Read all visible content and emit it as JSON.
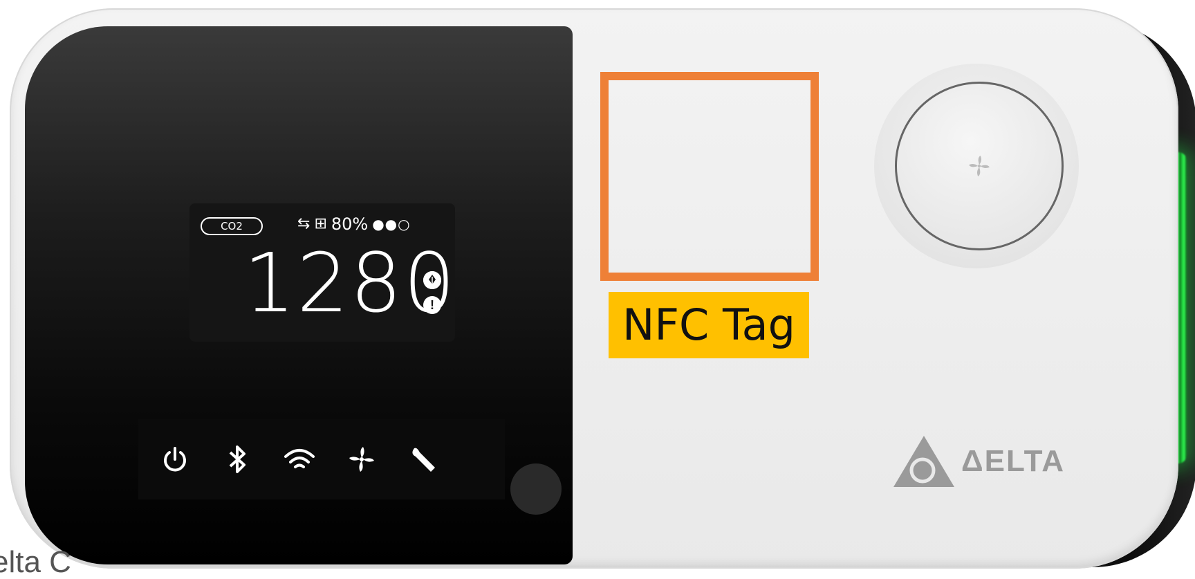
{
  "display": {
    "sensor_label": "CO2",
    "status_icons": [
      "sync-icon",
      "grid-icon"
    ],
    "humidity": "80%",
    "level_dots": "●●○",
    "reading": "1280",
    "indicator_icons": [
      "leaf-icon",
      "alert-icon"
    ]
  },
  "touch_controls": [
    {
      "name": "power-icon",
      "glyph": "⏻"
    },
    {
      "name": "bluetooth-icon",
      "glyph": "ᛒ"
    },
    {
      "name": "wifi-icon",
      "glyph": "wifi"
    },
    {
      "name": "fan-icon",
      "glyph": "fan"
    },
    {
      "name": "wrench-icon",
      "glyph": "wrench"
    }
  ],
  "nfc": {
    "label": "NFC Tag",
    "highlight_color": "#ee8037",
    "label_background": "#ffc000"
  },
  "brand": {
    "logo_text": "ΔELTA"
  },
  "caption": "elta C",
  "led_color": "#35ff55"
}
